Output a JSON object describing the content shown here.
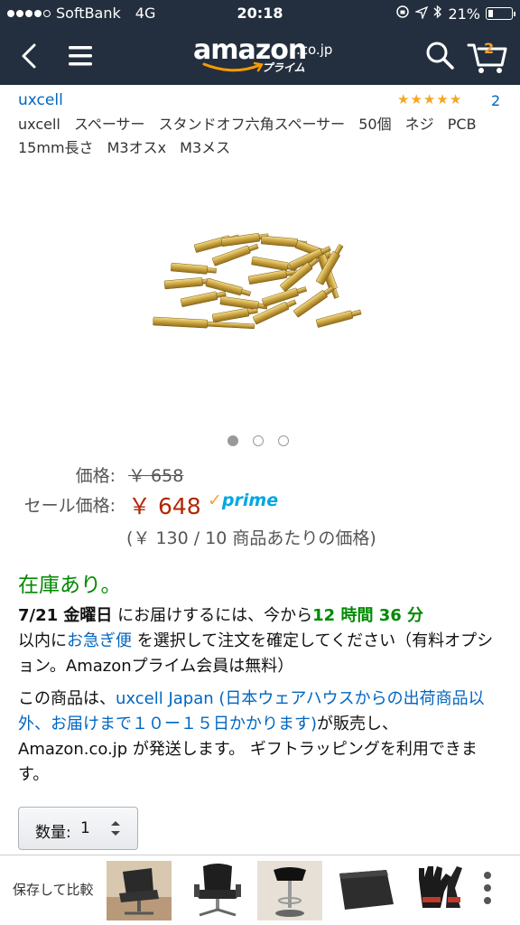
{
  "status_bar": {
    "carrier": "SoftBank",
    "network": "4G",
    "time": "20:18",
    "battery": "21%"
  },
  "header": {
    "logo_text": "amazon",
    "logo_tld": ".co.jp",
    "logo_prime": "プライム",
    "cart_count": "2"
  },
  "product": {
    "brand": "uxcell",
    "review_count": "2",
    "title": "uxcell スペーサー スタンドオフ六角スペーサー 50個 ネジ PCB 15mm長さ M3オスx M3メス",
    "rating_stars": 5
  },
  "price": {
    "list_label": "価格:",
    "list_price": "￥ 658",
    "sale_label": "セール価格:",
    "sale_price": "￥ 648",
    "prime": "prime",
    "unit_price": "(￥ 130 / 10 商品あたりの価格)"
  },
  "availability": {
    "stock": "在庫あり。",
    "date": "7/21 金曜日",
    "text1": " にお届けするには、今から",
    "countdown": "12 時間 36 分",
    "text2": "以内に",
    "express_link": "お急ぎ便",
    "text3": " を選択して注文を確定してください（有料オプション。Amazonプライム会員は無料）"
  },
  "seller": {
    "text1": "この商品は、",
    "seller_link": "uxcell Japan (日本ウェアハウスからの出荷商品以外、お届けまで１０ー１５日かかります)",
    "text2": "が販売し、Amazon.co.jp が発送します。 ギフトラッピングを利用できます。"
  },
  "quantity": {
    "label": "数量:",
    "value": "1"
  },
  "bottom": {
    "compare_label": "保存して比較"
  },
  "colors": {
    "header_bg": "#232f3e",
    "link": "#0066c0",
    "sale_price": "#b12704",
    "in_stock": "#008a00",
    "prime_blue": "#00a8e1",
    "star": "#f5a623"
  },
  "icons": [
    "back-chevron-icon",
    "hamburger-menu-icon",
    "search-icon",
    "cart-icon",
    "more-vertical-icon"
  ]
}
